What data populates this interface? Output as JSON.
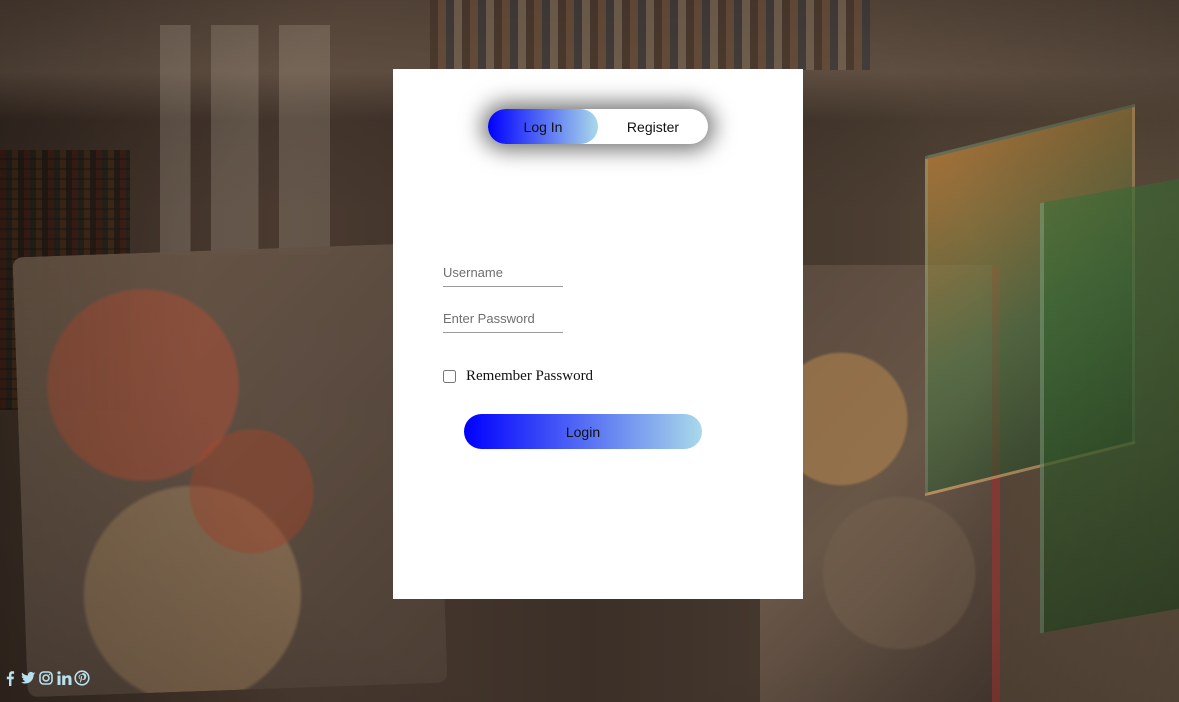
{
  "auth": {
    "tabs": {
      "login": "Log In",
      "register": "Register"
    },
    "form": {
      "username_placeholder": "Username",
      "password_placeholder": "Enter Password",
      "remember_label": "Remember Password",
      "submit_label": "Login"
    }
  },
  "social_icons": [
    "facebook-icon",
    "twitter-icon",
    "instagram-icon",
    "linkedin-icon",
    "pinterest-icon"
  ],
  "colors": {
    "accent_gradient_start": "#0000ff",
    "accent_gradient_end": "#a9d9ea",
    "icon_color": "#b7e1ee"
  }
}
